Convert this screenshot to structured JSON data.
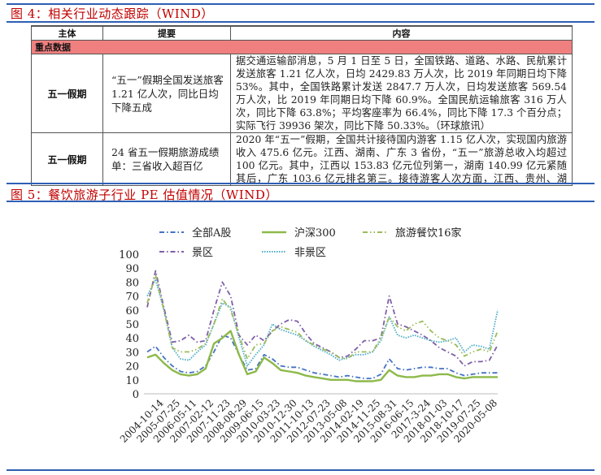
{
  "figure4": {
    "title": "图 4：相关行业动态跟踪（WIND）",
    "headers": [
      "主体",
      "提要",
      "内容"
    ],
    "section": "重点数据",
    "rows": [
      {
        "subject": "五一假期",
        "summary": "“五一”假期全国发送旅客 1.21 亿人次，同比日均下降五成",
        "content": "据交通运输部消息，5 月 1 日至 5 日，全国铁路、道路、水路、民航累计发送旅客 1.21 亿人次，日均 2429.83 万人次，比 2019 年同期日均下降 53%。其中，全国铁路累计发送 2847.7 万人次，日均发送旅客 569.54 万人次，比 2019 年同期日均下降 60.9%。全国民航运输旅客 316 万人次，同比下降 63.8%；平均客座率为 66.4%，同比下降 17.3 个百分点；实际飞行 39936 架次，同比下降 50.33%。（环球旅讯）"
      },
      {
        "subject": "五一假期",
        "summary": "24 省五一假期旅游成绩单：三省收入超百亿",
        "content": "2020 年“五一”假期，全国共计接待国内游客 1.15 亿人次，实现国内旅游收入 475.6 亿元。江西、湖南、广东 3 省份，“五一”旅游总收入均超过 100 亿元。其中，江西以 153.83 亿元位列第一，湖南 140.99 亿元紧随其后，广东 103.6 亿元排名第三。接待游客人次方面，江西、贵州、湖南、广东、河南、山东、"
      }
    ]
  },
  "figure5": {
    "title": "图 5：餐饮旅游子行业 PE 估值情况（WIND）"
  },
  "chart_data": {
    "type": "line",
    "title": "",
    "xlabel": "",
    "ylabel": "",
    "ylim": [
      0,
      100
    ],
    "yticks": [
      "0",
      "10",
      "20",
      "30",
      "40",
      "50",
      "60",
      "70",
      "80",
      "90",
      "100"
    ],
    "xtick_labels": [
      "2004-10-14",
      "2005-07-25",
      "2006-05-11",
      "2007-02-12",
      "2007-11-23",
      "2008-08-29",
      "2009-06-15",
      "2010-03-23",
      "2010-12-30",
      "2011-10-13",
      "2012-07-23",
      "2013-05-08",
      "2014-02-19",
      "2014-11-25",
      "2015-08-31",
      "2016-06-15",
      "2017-3-24",
      "2018-01-03",
      "2018-10-17",
      "2019-07-25",
      "2020-05-08"
    ],
    "x_tick_index_start": -1,
    "x_step": 0.5,
    "legend_placement": "top",
    "series": [
      {
        "name": "全部A股",
        "color": "#4472c4",
        "style": "dashdot",
        "values": [
          30,
          34,
          26,
          20,
          16,
          15,
          16,
          20,
          30,
          42,
          40,
          28,
          17,
          18,
          28,
          25,
          20,
          19,
          19,
          17,
          15,
          14,
          13,
          12,
          13,
          12,
          11,
          11,
          14,
          25,
          18,
          17,
          18,
          19,
          19,
          18,
          18,
          15,
          13,
          14,
          15,
          15,
          15
        ]
      },
      {
        "name": "沪深300",
        "color": "#8db94a",
        "style": "solid",
        "values": [
          26,
          28,
          22,
          17,
          14,
          13,
          14,
          18,
          36,
          40,
          45,
          28,
          14,
          16,
          26,
          22,
          17,
          16,
          15,
          13,
          12,
          11,
          10,
          10,
          10,
          9,
          9,
          9,
          10,
          17,
          13,
          12,
          12,
          13,
          13,
          14,
          14,
          12,
          11,
          12,
          12,
          12,
          12
        ]
      },
      {
        "name": "旅游餐饮16家",
        "color": "#9bbb59",
        "style": "dashdotdot",
        "values": [
          65,
          85,
          60,
          33,
          30,
          30,
          32,
          36,
          50,
          68,
          60,
          42,
          25,
          35,
          36,
          45,
          48,
          46,
          44,
          38,
          35,
          32,
          30,
          26,
          25,
          30,
          30,
          30,
          40,
          55,
          48,
          45,
          50,
          52,
          45,
          40,
          38,
          35,
          27,
          30,
          32,
          30,
          45
        ]
      },
      {
        "name": "景区",
        "color": "#7f5fa8",
        "style": "dashdot",
        "values": [
          62,
          88,
          62,
          37,
          38,
          42,
          37,
          38,
          60,
          80,
          70,
          42,
          35,
          42,
          38,
          45,
          50,
          53,
          52,
          43,
          36,
          33,
          30,
          26,
          27,
          32,
          38,
          38,
          40,
          70,
          50,
          48,
          45,
          42,
          38,
          33,
          30,
          27,
          20,
          23,
          23,
          24,
          35
        ]
      },
      {
        "name": "非景区",
        "color": "#4bacc6",
        "style": "dotted",
        "values": [
          70,
          82,
          60,
          33,
          25,
          24,
          30,
          35,
          50,
          65,
          62,
          40,
          20,
          28,
          35,
          50,
          46,
          44,
          42,
          38,
          34,
          31,
          28,
          24,
          26,
          28,
          28,
          30,
          38,
          55,
          42,
          40,
          42,
          40,
          38,
          37,
          38,
          40,
          30,
          35,
          34,
          32,
          60
        ]
      }
    ]
  }
}
